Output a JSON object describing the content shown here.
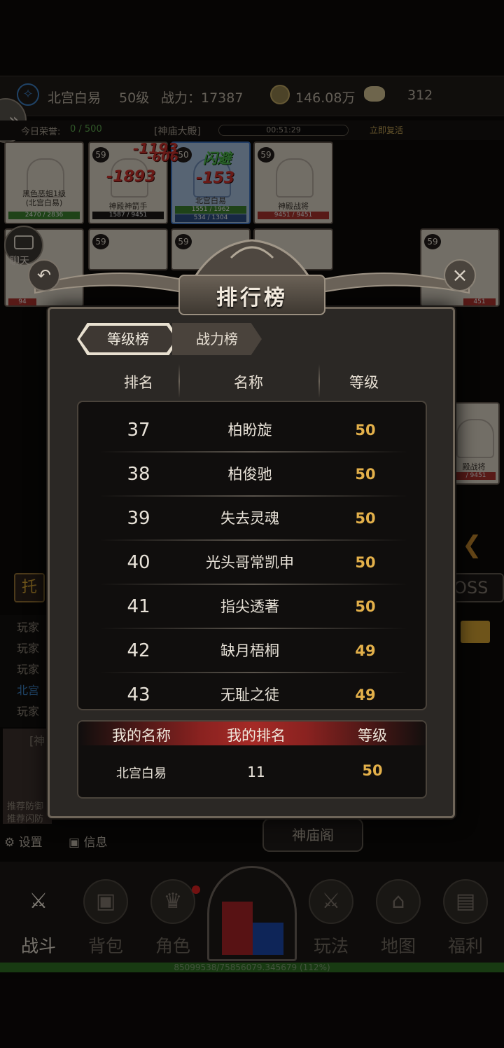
{
  "topbar": {
    "player_name": "北宫白易",
    "level": "50级",
    "power_label": "战力：17387",
    "coins": "146.08万",
    "ingots": "312"
  },
  "status": {
    "honor_label": "今日荣誉:",
    "honor_value": "0 / 500",
    "location": "[神庙大殿]",
    "timer": "00:51:29",
    "revive": "立即复活"
  },
  "battle": {
    "cards": [
      {
        "name": "黑色恶蛆1级\n(北宫白易)",
        "hp": "2470 / 2836",
        "level": ""
      },
      {
        "name": "神殿神箭手",
        "hp": "1587 / 9451",
        "level": "59"
      },
      {
        "name": "北宫白易",
        "hp": "1551 / 1962",
        "mp": "534 / 1304",
        "level": "50"
      },
      {
        "name": "神殿战将",
        "hp": "9451 / 9451",
        "level": "59"
      }
    ],
    "damage": [
      "-1193",
      "-606",
      "-1893",
      "-153",
      "闪避"
    ],
    "chat_label": "聊天",
    "partial_hp": "94",
    "partial_hp2": "451",
    "right_card_name": "殿战将",
    "right_card_hp": "/ 9451",
    "boss_label": "OSS",
    "auto_label": "托"
  },
  "log": {
    "lines": [
      "玩家",
      "玩家",
      "玩家",
      "北宫",
      "玩家"
    ],
    "map_label": "[神",
    "rec1": "推荐防御",
    "rec2": "推荐闪防"
  },
  "ranking": {
    "title": "排行榜",
    "tabs": [
      "等级榜",
      "战力榜"
    ],
    "columns": [
      "排名",
      "名称",
      "等级"
    ],
    "rows": [
      {
        "rank": "37",
        "name": "柏盼旋",
        "level": "50"
      },
      {
        "rank": "38",
        "name": "柏俊驰",
        "level": "50"
      },
      {
        "rank": "39",
        "name": "失去灵魂",
        "level": "50"
      },
      {
        "rank": "40",
        "name": "光头哥常凯申",
        "level": "50"
      },
      {
        "rank": "41",
        "name": "指尖透著",
        "level": "50"
      },
      {
        "rank": "42",
        "name": "缺月梧桐",
        "level": "49"
      },
      {
        "rank": "43",
        "name": "无耻之徒",
        "level": "49"
      }
    ],
    "mine": {
      "headers": [
        "我的名称",
        "我的排名",
        "等级"
      ],
      "name": "北宫白易",
      "rank": "11",
      "level": "50"
    }
  },
  "bottom": {
    "temple_button": "神庙阁",
    "settings": "设置",
    "info": "信息"
  },
  "nav": {
    "items": [
      "战斗",
      "背包",
      "角色",
      "玩法",
      "地图",
      "福利"
    ]
  },
  "exp_text": "85099538/75856079.345679 (112%)"
}
